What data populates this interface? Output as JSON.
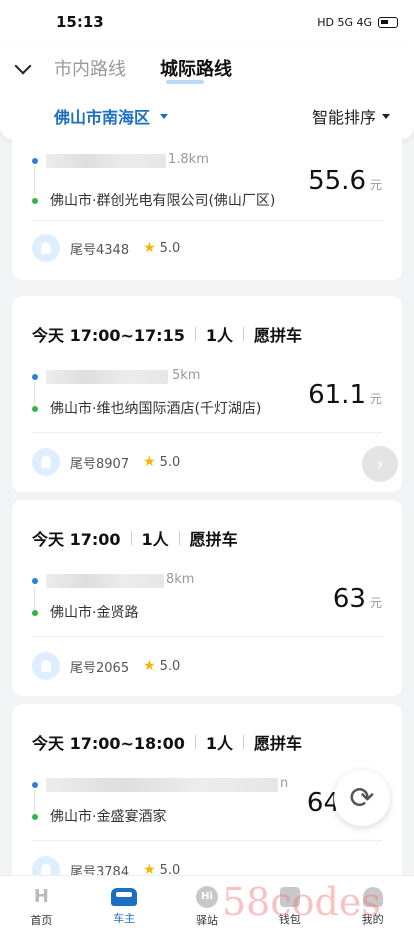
{
  "status": {
    "time": "15:13",
    "indicators": "HD 5G 4G"
  },
  "tabs": [
    "市内路线",
    "城际路线"
  ],
  "filters": {
    "city": "佛山市南海区",
    "sort": "智能排序"
  },
  "orders": [
    {
      "meta": [
        "",
        "",
        ""
      ],
      "dist": "1.8km",
      "dest": "佛山市·群创光电有限公司(佛山厂区)",
      "price": "55.6",
      "unit": "元",
      "plate": "尾号4348",
      "rating": "5.0"
    },
    {
      "meta": [
        "今天 17:00~17:15",
        "1人",
        "愿拼车"
      ],
      "dist": "5km",
      "dest": "佛山市·维也纳国际酒店(千灯湖店)",
      "price": "61.1",
      "unit": "元",
      "plate": "尾号8907",
      "rating": "5.0"
    },
    {
      "meta": [
        "今天 17:00",
        "1人",
        "愿拼车"
      ],
      "dist": "8km",
      "dest": "佛山市·金贤路",
      "price": "63",
      "unit": "元",
      "plate": "尾号2065",
      "rating": "5.0"
    },
    {
      "meta": [
        "今天 17:00~18:00",
        "1人",
        "愿拼车"
      ],
      "dist": "n",
      "dest": "佛山市·金盛宴酒家",
      "price": "64",
      "unit": "",
      "plate": "尾号3784",
      "rating": "5.0"
    }
  ],
  "nav": [
    "首页",
    "车主",
    "驿站",
    "钱包",
    "我的"
  ],
  "watermark": "58codes"
}
